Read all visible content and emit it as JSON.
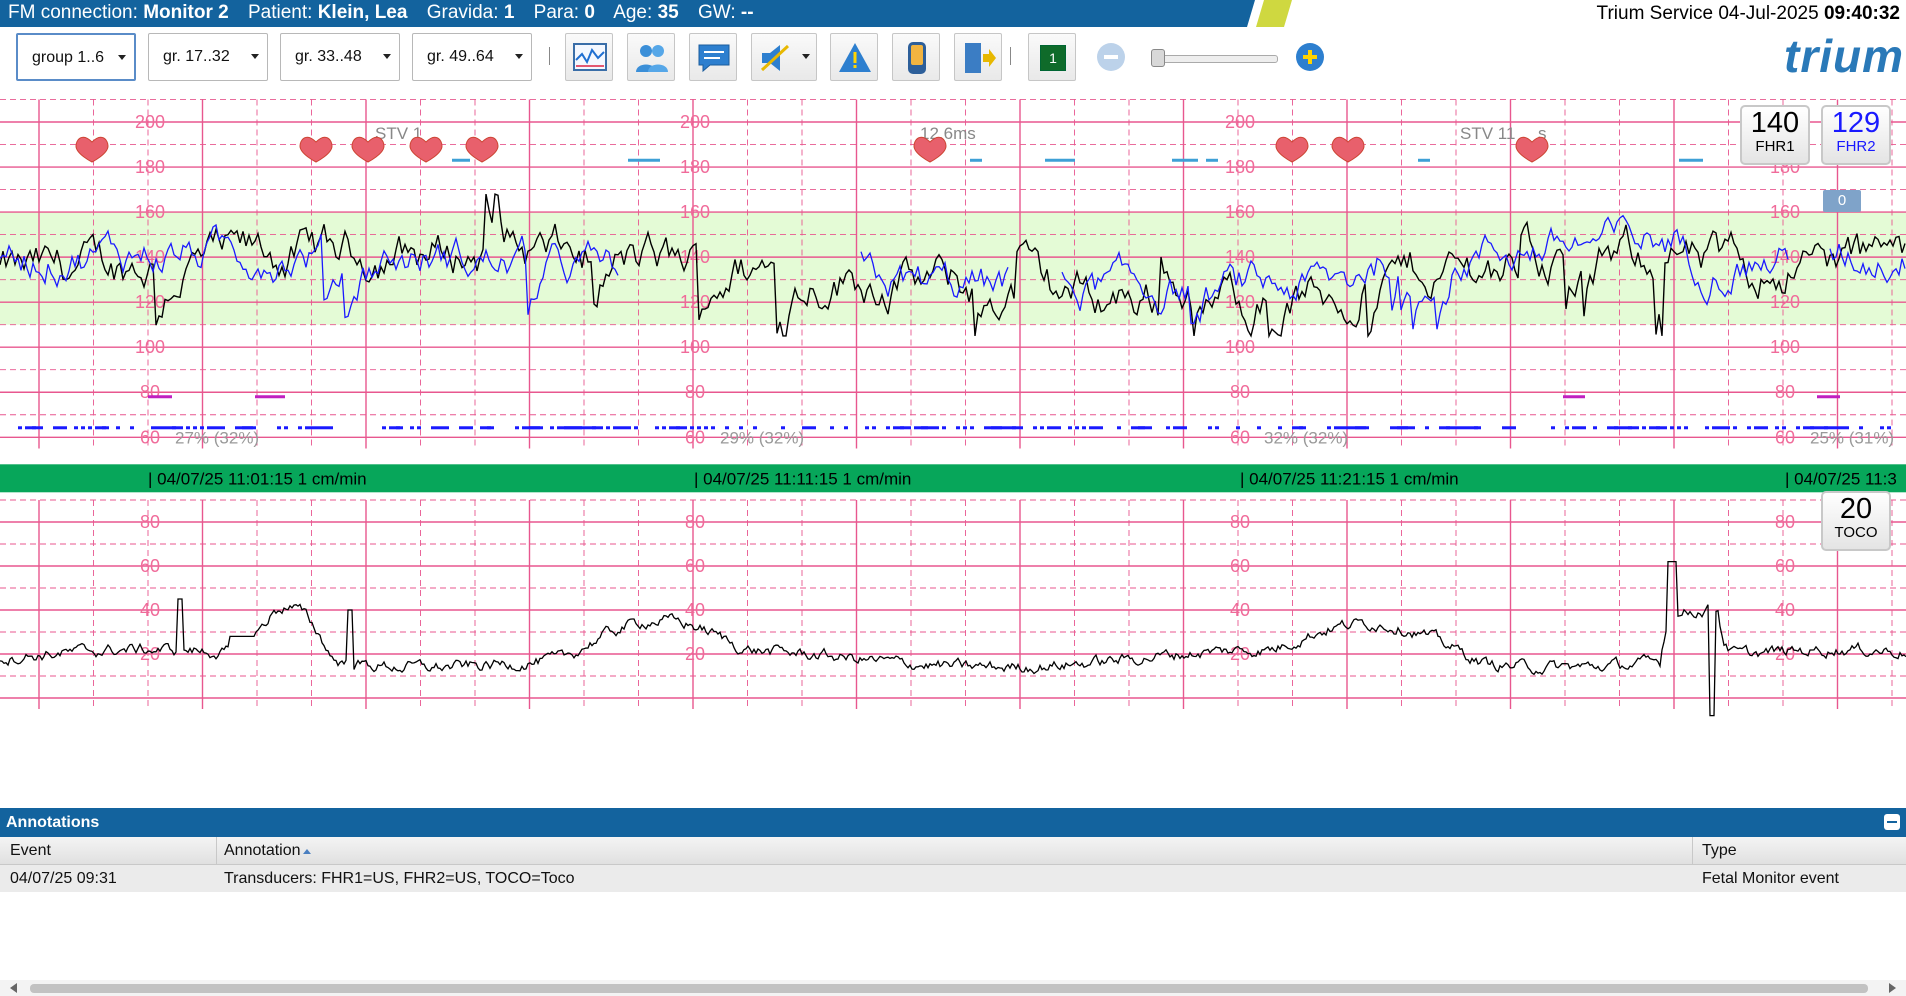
{
  "header": {
    "connection_label": "FM connection:",
    "connection_value": "Monitor 2",
    "patient_label": "Patient:",
    "patient_value": "Klein, Lea",
    "gravida_label": "Gravida:",
    "gravida_value": "1",
    "para_label": "Para:",
    "para_value": "0",
    "age_label": "Age:",
    "age_value": "35",
    "gw_label": "GW:",
    "gw_value": "--",
    "service": "Trium Service",
    "date": "04-Jul-2025",
    "time": "09:40:32"
  },
  "toolbar": {
    "groups": [
      "group 1..6",
      "gr. 17..32",
      "gr. 33..48",
      "gr. 49..64"
    ],
    "channel_button": "1",
    "logo": "trium",
    "icons": [
      "ctg-analysis-icon",
      "patients-icon",
      "comment-icon",
      "mute-icon",
      "alarm-warning-icon",
      "device-icon",
      "exit-icon",
      "channel-icon",
      "zoom-out-icon",
      "zoom-slider",
      "zoom-in-icon"
    ],
    "zoom_level": 0.02
  },
  "chart_data": {
    "type": "line",
    "fhr": {
      "y_ticks": [
        200,
        180,
        160,
        140,
        120,
        100,
        80,
        60
      ],
      "normal_band": [
        110,
        160
      ],
      "stv_labels": [
        "STV 1​​​ms",
        "​12,6ms",
        "STV 11,​​s"
      ],
      "stv_visible": [
        "STV 1",
        "12,6ms",
        "STV 11",
        "s"
      ],
      "signal_loss_labels": [
        "27% (32%)",
        "29% (32%)",
        "32% (32%)",
        "25% (31%)"
      ],
      "series": [
        {
          "name": "FHR1",
          "color": "#000000"
        },
        {
          "name": "FHR2",
          "color": "#1a1aff"
        }
      ]
    },
    "time_labels": [
      "| 04/07/25 11:01:15",
      "| 04/07/25 11:11:15",
      "| 04/07/25 11:21:15",
      "| 04/07/25 11:3"
    ],
    "paper_speed": "1 cm/min",
    "toco": {
      "y_ticks": [
        80,
        60,
        40,
        20
      ],
      "series": [
        {
          "name": "TOCO",
          "color": "#000000"
        }
      ]
    }
  },
  "badges": {
    "fhr1_value": "140",
    "fhr1_name": "FHR1",
    "fhr2_value": "129",
    "fhr2_name": "FHR2",
    "fhr2_offset": "0",
    "toco_value": "20",
    "toco_name": "TOCO"
  },
  "colors": {
    "header_blue": "#13639e",
    "accent_yellow": "#cfd840",
    "grid_pink": "#e8578f",
    "normal_band": "#e4fbd6",
    "time_bar": "#07a65a",
    "fhr2_blue": "#1a1aff"
  },
  "annotations": {
    "title": "Annotations",
    "columns": [
      "Event",
      "Annotation",
      "Type"
    ],
    "rows": [
      {
        "event": "04/07/25 09:31",
        "annotation": "Transducers: FHR1=US, FHR2=US, TOCO=Toco",
        "type": "Fetal Monitor event"
      }
    ]
  }
}
